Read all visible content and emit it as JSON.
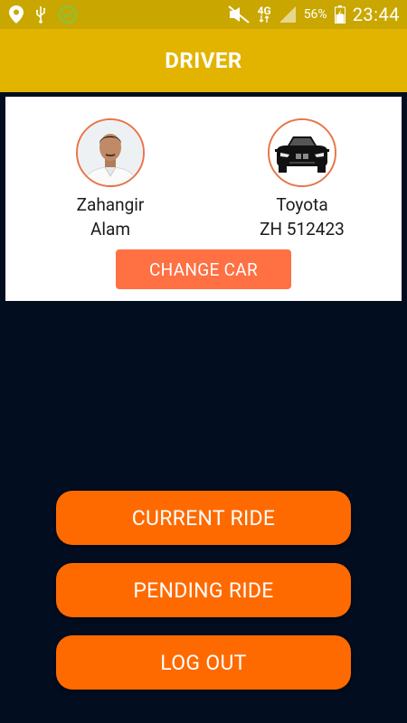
{
  "status_bar": {
    "network": "4G",
    "battery_percent": "56%",
    "time": "23:44",
    "left_icons": [
      "location-pin-icon",
      "usb-icon",
      "check-circle-icon"
    ],
    "right_icons": [
      "mute-icon",
      "network-4g-icon",
      "signal-icon",
      "battery-charging-icon"
    ]
  },
  "app_bar": {
    "title": "DRIVER"
  },
  "driver_card": {
    "driver": {
      "first_name": "Zahangir",
      "last_name": "Alam"
    },
    "car": {
      "make": "Toyota",
      "plate": "ZH 512423"
    },
    "change_car_label": "CHANGE CAR"
  },
  "actions": {
    "current_ride": "CURRENT RIDE",
    "pending_ride": "PENDING RIDE",
    "log_out": "LOG OUT"
  },
  "colors": {
    "status_bar": "#c9a700",
    "app_bar": "#e2b400",
    "background": "#020d1f",
    "change_car_button": "#ff7043",
    "action_button": "#ff6a00",
    "avatar_border": "#e8754a"
  }
}
